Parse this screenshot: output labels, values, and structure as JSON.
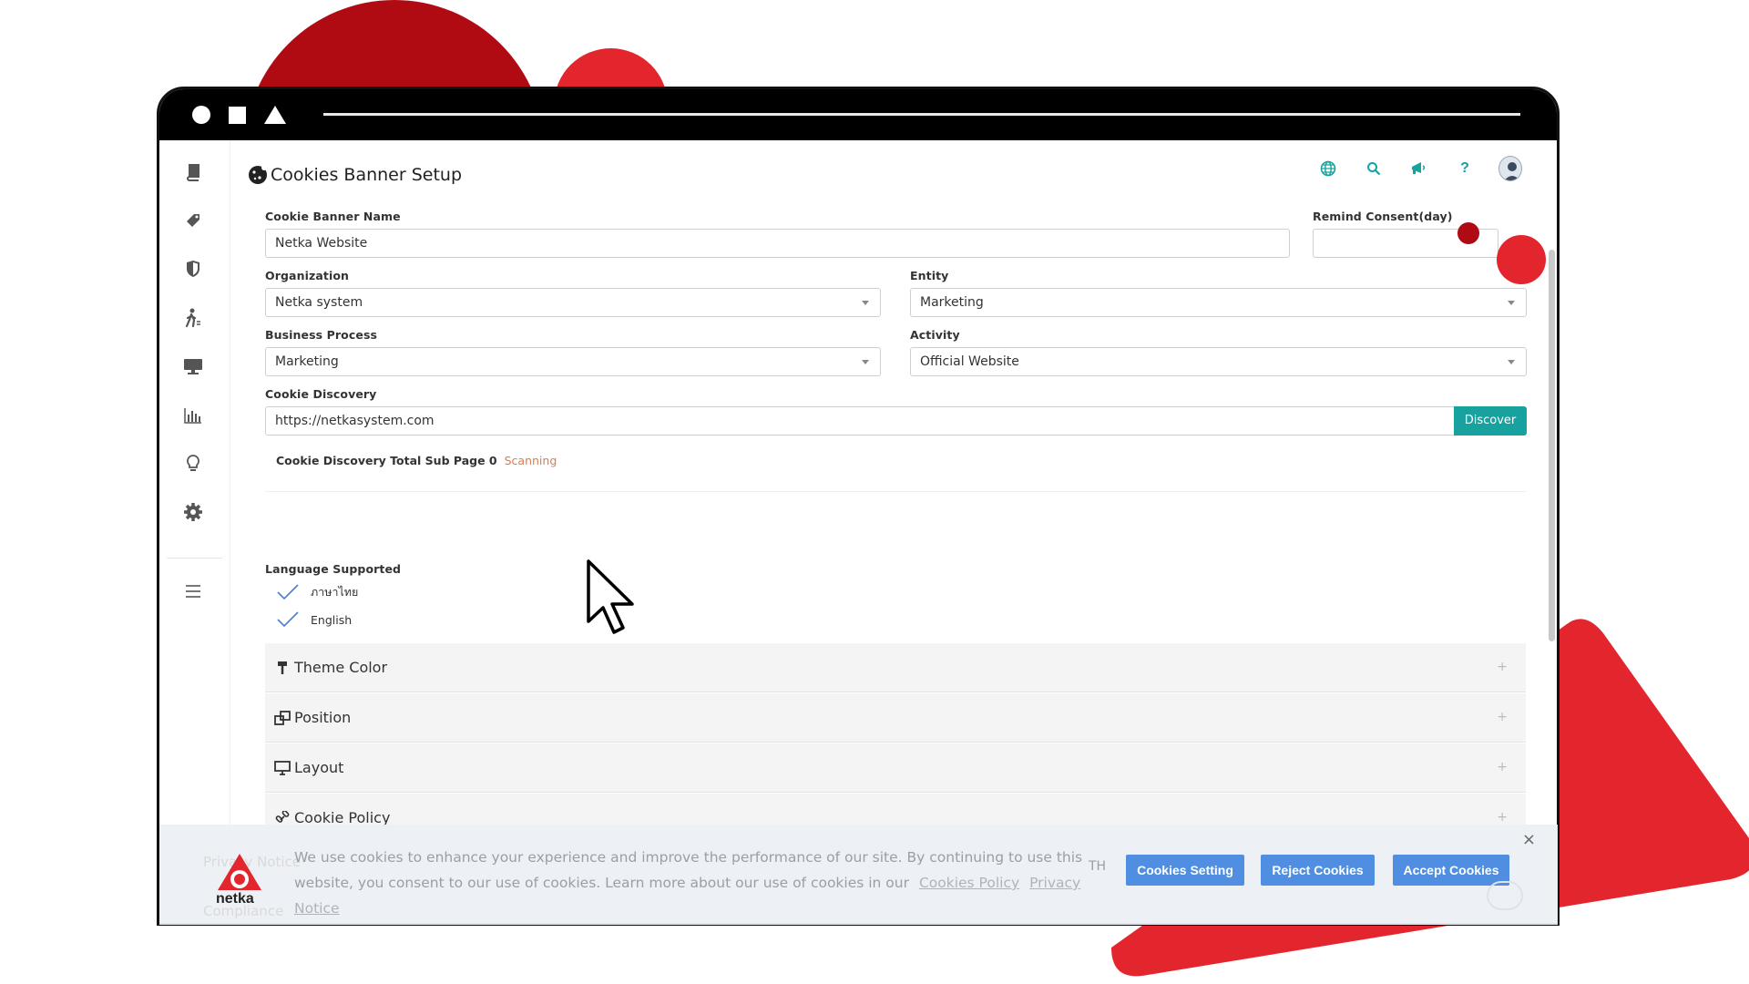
{
  "app": {
    "page_title": "Cookies Banner Setup"
  },
  "form": {
    "banner_name_label": "Cookie Banner Name",
    "banner_name_value": "Netka Website",
    "remind_label": "Remind Consent(day)",
    "remind_value": "",
    "organization_label": "Organization",
    "organization_value": "Netka system",
    "entity_label": "Entity",
    "entity_value": "Marketing",
    "business_process_label": "Business Process",
    "business_process_value": "Marketing",
    "activity_label": "Activity",
    "activity_value": "Official Website",
    "discovery_label": "Cookie Discovery",
    "discovery_value": "https://netkasystem.com",
    "discover_button": "Discover",
    "discovery_status_text": "Cookie Discovery Total Sub Page 0",
    "discovery_status_state": "Scanning",
    "language_label": "Language Supported",
    "languages": [
      "ภาษาไทย",
      "English"
    ]
  },
  "accordions": [
    {
      "label": "Theme Color",
      "icon": "paint-roller-icon"
    },
    {
      "label": "Position",
      "icon": "position-icon"
    },
    {
      "label": "Layout",
      "icon": "monitor-icon"
    },
    {
      "label": "Cookie Policy",
      "icon": "link-icon"
    }
  ],
  "faded_items": [
    "Privacy Notice",
    "Compliance"
  ],
  "banner": {
    "logo_text": "netka",
    "message": "We use cookies to enhance your experience and improve the performance of our site. By continuing to use this website, you consent to our use of cookies. Learn more about our use of cookies in our",
    "cookies_policy_link": "Cookies Policy",
    "privacy_notice_link": "Privacy Notice",
    "language": "TH",
    "cookies_setting_button": "Cookies Setting",
    "reject_button": "Reject Cookies",
    "accept_button": "Accept Cookies",
    "close": "×"
  },
  "sidebar_icons": [
    "book-icon",
    "tag-icon",
    "shield-icon",
    "person-walk-icon",
    "monitor-icon",
    "bar-chart-icon",
    "lightbulb-icon",
    "gear-icon",
    "menu-icon"
  ],
  "colors": {
    "accent_teal": "#17a2a0",
    "scanning_orange": "#e07a4b",
    "banner_button_blue": "#4f8ee0",
    "brand_red": "#e3262d",
    "brand_dark_red": "#b00a13"
  }
}
